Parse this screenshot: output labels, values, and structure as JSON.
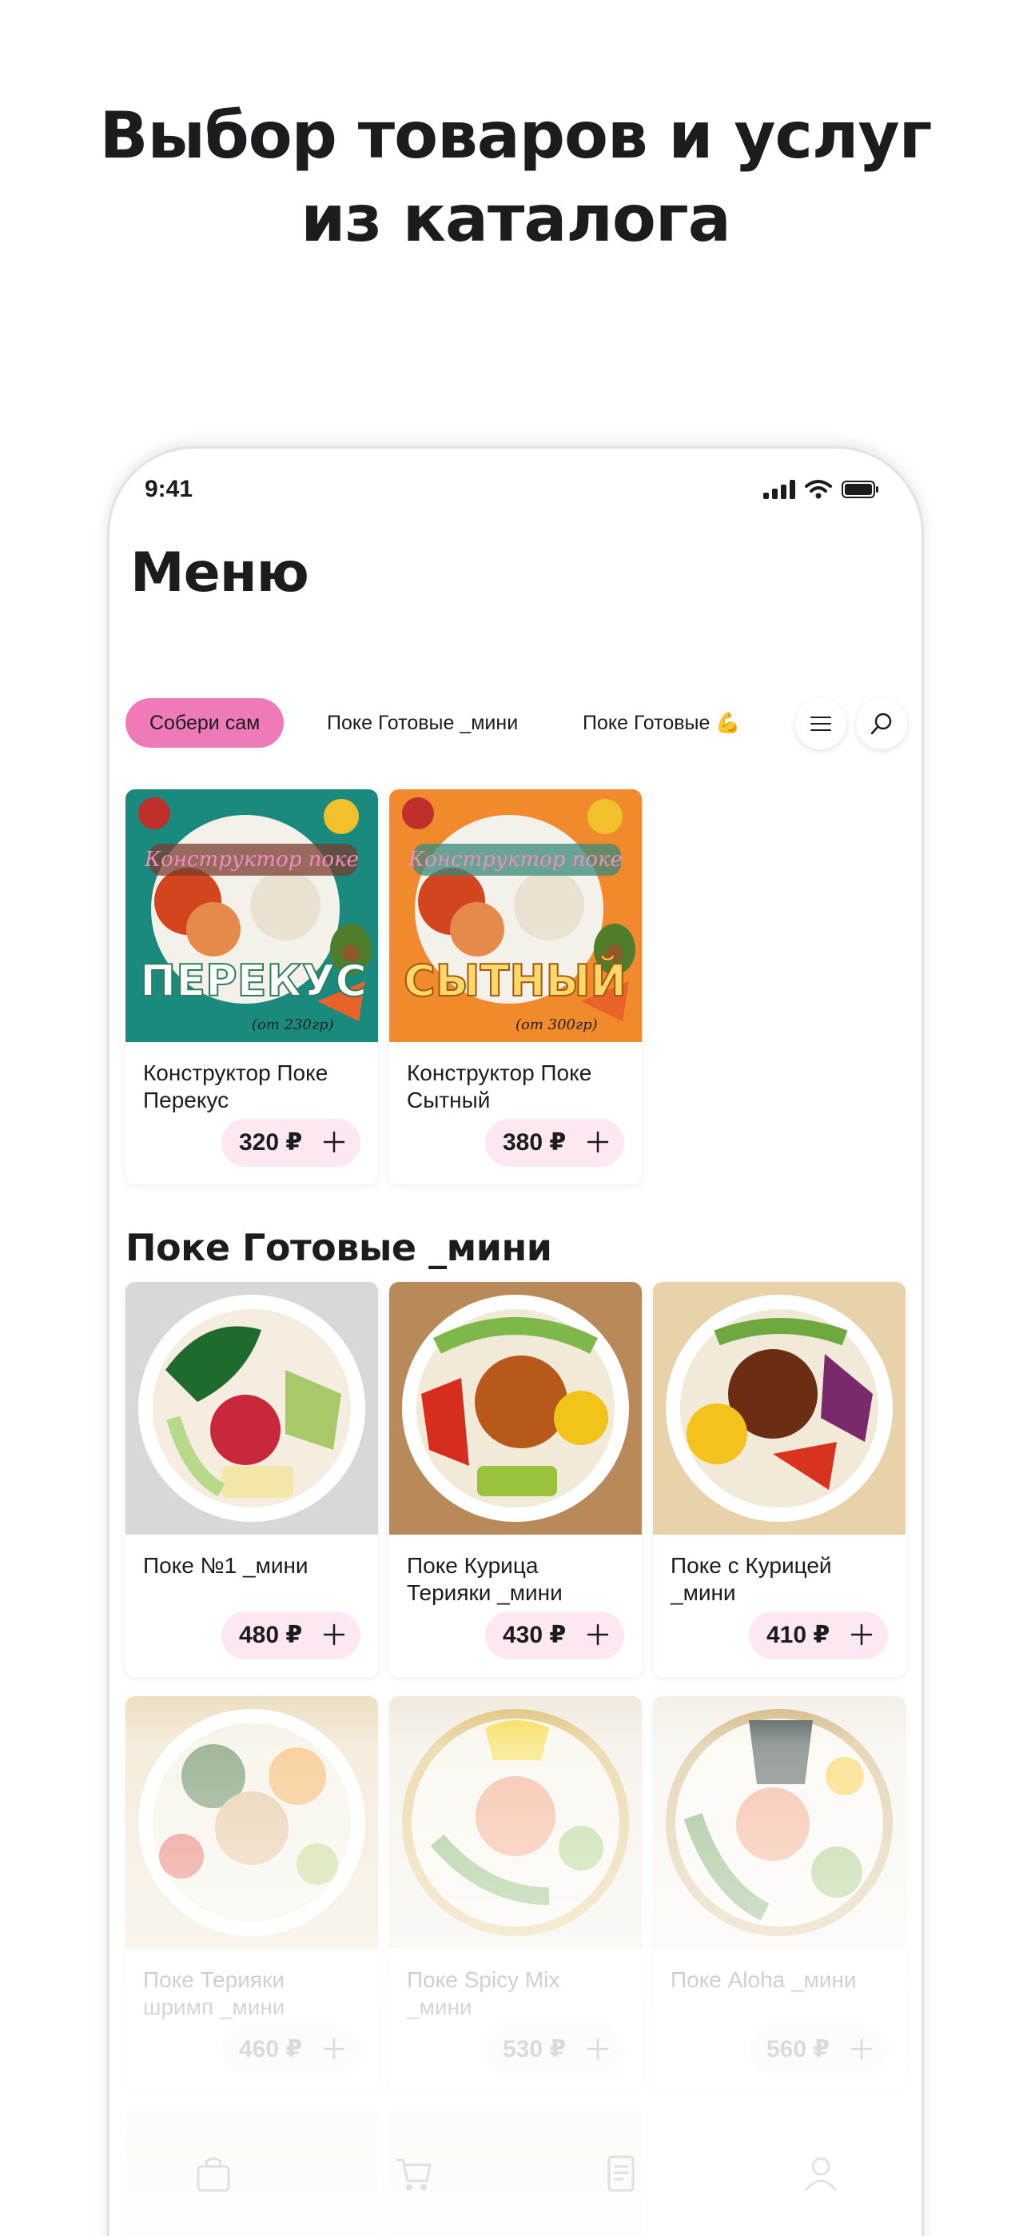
{
  "headline": {
    "line1": "Выбор товаров и услуг",
    "line2": "из каталога"
  },
  "status_bar": {
    "time": "9:41"
  },
  "screen": {
    "title": "Меню"
  },
  "tabs": [
    {
      "label": "Собери сам",
      "active": true
    },
    {
      "label": "Поке Готовые _мини",
      "active": false
    },
    {
      "label": "Поке Готовые 💪",
      "active": false
    }
  ],
  "featured": [
    {
      "name_line1": "Конструктор Поке",
      "name_line2": "Перекус",
      "price": "320 ₽",
      "banner_title": "Конструктор поке",
      "banner_label": "ПЕРЕКУС",
      "banner_weight": "(от 230гр)",
      "bg": "#1a8a7e"
    },
    {
      "name_line1": "Конструктор Поке",
      "name_line2": "Сытный",
      "price": "380 ₽",
      "banner_title": "Конструктор поке",
      "banner_label": "СЫТНЫЙ",
      "banner_weight": "(от 300гр)",
      "bg": "#f08a2c"
    }
  ],
  "section": {
    "title": "Поке Готовые _мини"
  },
  "products": [
    {
      "name_line1": "Поке №1 _мини",
      "name_line2": "",
      "price": "480 ₽"
    },
    {
      "name_line1": "Поке Курица",
      "name_line2": "Терияки _мини",
      "price": "430 ₽"
    },
    {
      "name_line1": "Поке с Курицей",
      "name_line2": "_мини",
      "price": "410 ₽"
    },
    {
      "name_line1": "Поке Терияки",
      "name_line2": "шримп _мини",
      "price": "460 ₽"
    },
    {
      "name_line1": "Поке Spicy Mix",
      "name_line2": "_мини",
      "price": "530 ₽"
    },
    {
      "name_line1": "Поке Aloha _мини",
      "name_line2": "",
      "price": "560 ₽"
    }
  ],
  "colors": {
    "accent": "#ee7ab8",
    "price_pill": "#fde7f2"
  },
  "icons": [
    "signal-icon",
    "wifi-icon",
    "battery-icon",
    "menu-icon",
    "search-icon",
    "plus-icon",
    "bag-icon",
    "cart-icon",
    "orders-icon",
    "profile-icon"
  ]
}
